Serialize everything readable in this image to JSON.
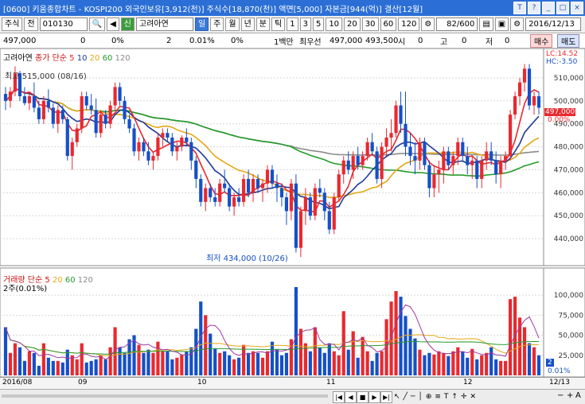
{
  "title_bar": {
    "window_id": "1",
    "text": "[0600] 키움종합차트 - KOSPI200 외국인보유[3,912(천)] 주식수[18,870(천)] 액면[5,000] 자본금[944(억)] 결산[12월]"
  },
  "toolbar": {
    "type_select": "주식",
    "prev_label": "전",
    "code": "010130",
    "sound_icon": "◀",
    "sin_badge": "신",
    "stock_name": "고려아연",
    "period_tabs": [
      "일",
      "주",
      "월",
      "년",
      "분",
      "틱"
    ],
    "minute_tabs": [
      "1",
      "3",
      "5",
      "10",
      "20",
      "30",
      "60",
      "120"
    ],
    "count": "82/600",
    "date": "2016/12/13"
  },
  "info_row": {
    "price": "497,000",
    "change": "0",
    "change_pct": "0%",
    "qty": "2",
    "qty_pct": "0.01%",
    "pct3": "0%",
    "trade_label": "1백만",
    "best_bid_label": "최우선",
    "best_bid": "497,000",
    "best_ask": "493,500",
    "ha": "시",
    "ha_val": "0",
    "go": "고",
    "go_val": "0",
    "je": "저",
    "je_val": "0",
    "buy": "매수",
    "sell": "매도"
  },
  "price_panel": {
    "name": "고려아연",
    "ma_label": "종가 단순",
    "ma_periods": [
      "5",
      "10",
      "20",
      "60",
      "120"
    ],
    "high_note": "최고 515,000 (08/16)",
    "low_note": "최저 434,000 (10/26)",
    "lc": "LC:14.52",
    "hc": "HC:-3.50",
    "current_price": "497,000",
    "current_pct": "0.00%",
    "y_ticks": [
      "510,000",
      "500,000",
      "490,000",
      "480,000",
      "470,000",
      "460,000",
      "450,000",
      "440,000"
    ]
  },
  "volume_panel": {
    "label": "거래량 단순",
    "ma_periods": [
      "5",
      "20",
      "60",
      "120"
    ],
    "sub": "2주(0.01%)",
    "y_ticks": [
      "100,000",
      "75,000",
      "50,000",
      "25,000"
    ],
    "current": "2",
    "current_pct": "0.01%"
  },
  "x_axis": {
    "labels": [
      "2016/08",
      "09",
      "10",
      "11",
      "12",
      "12/13"
    ]
  },
  "colors": {
    "up": "#e8292f",
    "down": "#1450c8",
    "ma5": "#e8292f",
    "ma10": "#1e3c96",
    "ma20": "#e4a817",
    "ma60": "#249a2a",
    "ma120": "#8c8c8c"
  },
  "chart_data": {
    "type": "candlestick",
    "price_range": [
      430000,
      520000
    ],
    "volume_range": [
      0,
      110000
    ],
    "candles": [
      [
        503,
        506,
        496,
        500,
        60
      ],
      [
        500,
        506,
        497,
        504,
        28
      ],
      [
        504,
        515,
        502,
        512,
        40
      ],
      [
        512,
        513,
        500,
        502,
        35
      ],
      [
        502,
        506,
        498,
        499,
        18
      ],
      [
        499,
        504,
        496,
        502,
        30
      ],
      [
        502,
        508,
        495,
        497,
        28
      ],
      [
        497,
        500,
        490,
        492,
        12
      ],
      [
        492,
        502,
        490,
        500,
        40
      ],
      [
        500,
        505,
        495,
        497,
        22
      ],
      [
        497,
        499,
        488,
        490,
        18
      ],
      [
        490,
        498,
        486,
        496,
        18
      ],
      [
        496,
        498,
        490,
        492,
        16
      ],
      [
        492,
        493,
        474,
        476,
        32
      ],
      [
        476,
        484,
        470,
        482,
        25
      ],
      [
        482,
        490,
        480,
        488,
        20
      ],
      [
        488,
        504,
        486,
        502,
        40
      ],
      [
        502,
        504,
        496,
        498,
        16
      ],
      [
        498,
        503,
        494,
        496,
        18
      ],
      [
        496,
        501,
        484,
        486,
        20
      ],
      [
        486,
        496,
        484,
        494,
        25
      ],
      [
        494,
        496,
        488,
        490,
        20
      ],
      [
        490,
        500,
        488,
        498,
        35
      ],
      [
        498,
        508,
        496,
        506,
        60
      ],
      [
        506,
        508,
        498,
        500,
        35
      ],
      [
        500,
        502,
        490,
        492,
        28
      ],
      [
        492,
        494,
        486,
        488,
        45
      ],
      [
        488,
        490,
        476,
        478,
        50
      ],
      [
        478,
        484,
        474,
        482,
        38
      ],
      [
        482,
        484,
        476,
        478,
        28
      ],
      [
        478,
        482,
        472,
        474,
        32
      ],
      [
        474,
        478,
        470,
        476,
        28
      ],
      [
        476,
        486,
        474,
        484,
        42
      ],
      [
        484,
        488,
        480,
        486,
        30
      ],
      [
        486,
        488,
        482,
        484,
        30
      ],
      [
        484,
        486,
        476,
        478,
        20
      ],
      [
        478,
        482,
        474,
        480,
        22
      ],
      [
        480,
        485,
        478,
        484,
        26
      ],
      [
        484,
        488,
        480,
        482,
        30
      ],
      [
        482,
        484,
        470,
        474,
        35
      ],
      [
        474,
        476,
        462,
        466,
        58
      ],
      [
        466,
        468,
        454,
        456,
        92
      ],
      [
        456,
        464,
        452,
        462,
        75
      ],
      [
        462,
        464,
        456,
        458,
        52
      ],
      [
        458,
        462,
        454,
        456,
        33
      ],
      [
        456,
        466,
        454,
        464,
        28
      ],
      [
        464,
        470,
        460,
        462,
        30
      ],
      [
        462,
        464,
        452,
        454,
        25
      ],
      [
        454,
        460,
        450,
        458,
        20
      ],
      [
        458,
        462,
        454,
        456,
        22
      ],
      [
        456,
        468,
        454,
        466,
        38
      ],
      [
        466,
        470,
        458,
        460,
        28
      ],
      [
        460,
        468,
        456,
        466,
        30
      ],
      [
        466,
        468,
        460,
        462,
        28
      ],
      [
        462,
        466,
        456,
        464,
        22
      ],
      [
        464,
        472,
        460,
        470,
        30
      ],
      [
        470,
        472,
        462,
        464,
        42
      ],
      [
        464,
        468,
        456,
        462,
        32
      ],
      [
        462,
        464,
        454,
        458,
        25
      ],
      [
        458,
        460,
        446,
        452,
        28
      ],
      [
        452,
        466,
        448,
        464,
        45
      ],
      [
        464,
        468,
        434,
        436,
        110
      ],
      [
        436,
        454,
        432,
        452,
        58
      ],
      [
        452,
        462,
        446,
        458,
        40
      ],
      [
        458,
        460,
        448,
        450,
        30
      ],
      [
        450,
        464,
        448,
        462,
        60
      ],
      [
        462,
        466,
        458,
        460,
        35
      ],
      [
        460,
        462,
        448,
        452,
        28
      ],
      [
        452,
        456,
        442,
        444,
        40
      ],
      [
        444,
        460,
        442,
        458,
        30
      ],
      [
        458,
        470,
        456,
        468,
        25
      ],
      [
        468,
        476,
        464,
        474,
        80
      ],
      [
        474,
        478,
        468,
        470,
        32
      ],
      [
        470,
        478,
        466,
        476,
        55
      ],
      [
        476,
        480,
        470,
        472,
        22
      ],
      [
        472,
        478,
        470,
        476,
        48
      ],
      [
        476,
        484,
        474,
        482,
        30
      ],
      [
        482,
        486,
        476,
        478,
        18
      ],
      [
        478,
        480,
        464,
        466,
        28
      ],
      [
        466,
        482,
        462,
        480,
        30
      ],
      [
        480,
        488,
        476,
        484,
        70
      ],
      [
        484,
        492,
        478,
        486,
        92
      ],
      [
        486,
        500,
        484,
        498,
        105
      ],
      [
        498,
        504,
        486,
        490,
        98
      ],
      [
        490,
        504,
        476,
        480,
        74
      ],
      [
        480,
        486,
        472,
        476,
        58
      ],
      [
        476,
        482,
        468,
        474,
        46
      ],
      [
        474,
        484,
        470,
        482,
        32
      ],
      [
        482,
        484,
        470,
        472,
        25
      ],
      [
        472,
        474,
        458,
        462,
        28
      ],
      [
        462,
        472,
        458,
        468,
        26
      ],
      [
        468,
        474,
        460,
        470,
        30
      ],
      [
        470,
        480,
        464,
        478,
        28
      ],
      [
        478,
        480,
        470,
        472,
        24
      ],
      [
        472,
        478,
        468,
        476,
        30
      ],
      [
        476,
        484,
        472,
        482,
        35
      ],
      [
        482,
        484,
        474,
        476,
        30
      ],
      [
        476,
        480,
        468,
        472,
        22
      ],
      [
        472,
        476,
        466,
        474,
        33
      ],
      [
        474,
        476,
        462,
        466,
        20
      ],
      [
        466,
        476,
        462,
        474,
        25
      ],
      [
        474,
        482,
        470,
        478,
        28
      ],
      [
        478,
        482,
        472,
        474,
        35
      ],
      [
        474,
        478,
        464,
        468,
        20
      ],
      [
        468,
        476,
        462,
        474,
        18
      ],
      [
        474,
        478,
        470,
        476,
        18
      ],
      [
        476,
        496,
        474,
        494,
        95
      ],
      [
        494,
        504,
        492,
        502,
        98
      ],
      [
        502,
        510,
        498,
        508,
        72
      ],
      [
        508,
        516,
        504,
        514,
        60
      ],
      [
        514,
        516,
        496,
        498,
        40
      ],
      [
        498,
        504,
        494,
        502,
        35
      ],
      [
        502,
        504,
        494,
        497,
        25
      ]
    ]
  }
}
